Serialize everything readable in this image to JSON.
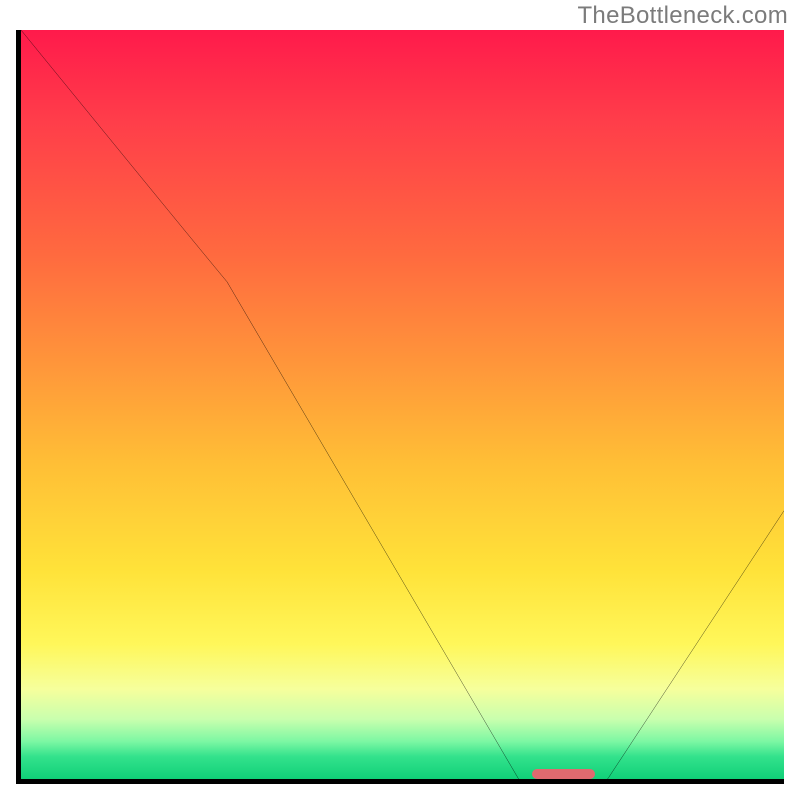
{
  "watermark": "TheBottleneck.com",
  "colors": {
    "axis": "#000000",
    "curve": "#000000",
    "marker": "#e06a6f",
    "watermark_text": "#7b7b7b",
    "gradient_top": "#ff1a4b",
    "gradient_bottom": "#10d078"
  },
  "chart_data": {
    "type": "line",
    "title": "",
    "xlabel": "",
    "ylabel": "",
    "xlim": [
      0,
      100
    ],
    "ylim": [
      0,
      100
    ],
    "grid": false,
    "legend": false,
    "marker_range_x": [
      67,
      75
    ],
    "curve_points": [
      {
        "x": 0,
        "y": 100
      },
      {
        "x": 25,
        "y": 70
      },
      {
        "x": 67,
        "y": 0
      },
      {
        "x": 75,
        "y": 0
      },
      {
        "x": 100,
        "y": 37
      }
    ],
    "notes": "Single black curve over a vertical red→green gradient. Curve descends steeply from top-left, touches the x-axis around x≈67–75 (flat minimum), then rises toward the right edge. A short salmon-colored pill marks the flat minimum on the x-axis. Only axes present are left and bottom (black); no tick labels shown."
  }
}
